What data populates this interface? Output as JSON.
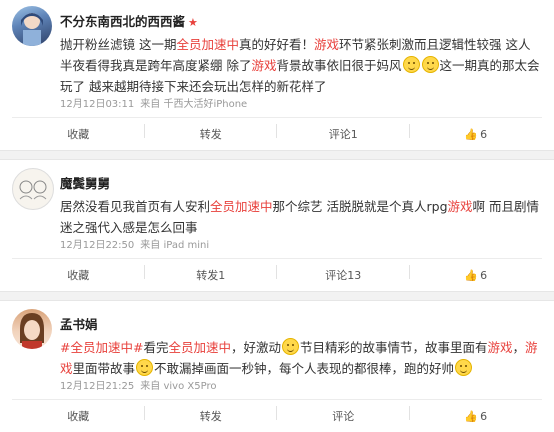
{
  "posts": [
    {
      "username": "不分东南西北的西西酱",
      "segments": [
        {
          "t": "抛开粉丝滤镜 这一期",
          "c": ""
        },
        {
          "t": "全员加速中",
          "c": "red"
        },
        {
          "t": "真的好好看！",
          "c": ""
        },
        {
          "t": "游戏",
          "c": "pink"
        },
        {
          "t": "环节紧张刺激而且逻辑性较强 这人半夜看得我真是跨年高度紧绷 除了",
          "c": ""
        },
        {
          "t": "游戏",
          "c": "pink"
        },
        {
          "t": "背景故事依旧很于妈风",
          "c": ""
        },
        {
          "t": "EMOJI",
          "c": "emoji"
        },
        {
          "t": "EMOJI",
          "c": "emoji"
        },
        {
          "t": "这一期真的那太会玩了 越来越期待接下来还会玩出怎样的新花样了",
          "c": ""
        }
      ],
      "meta": [
        "12月12日03:11",
        "来自 千西大活好iPhone"
      ],
      "actions": {
        "collect": "收藏",
        "repost": "转发",
        "comment": "评论1",
        "like": "6"
      }
    },
    {
      "username": "魔鬓舅舅",
      "segments": [
        {
          "t": "居然没看见我首页有人安利",
          "c": ""
        },
        {
          "t": "全员加速中",
          "c": "red"
        },
        {
          "t": "那个综艺 活脱脱就是个真人rpg",
          "c": ""
        },
        {
          "t": "游戏",
          "c": "pink"
        },
        {
          "t": "啊 而且剧情迷之强代入感是怎么回事",
          "c": ""
        }
      ],
      "meta": [
        "12月12日22:50",
        "来自 iPad mini"
      ],
      "actions": {
        "collect": "收藏",
        "repost": "转发1",
        "comment": "评论13",
        "like": "6"
      }
    },
    {
      "username": "孟书娟",
      "segments": [
        {
          "t": "#全员加速中#",
          "c": "red"
        },
        {
          "t": "看完",
          "c": ""
        },
        {
          "t": "全员加速中",
          "c": "red"
        },
        {
          "t": "，好激动",
          "c": ""
        },
        {
          "t": "EMOJI",
          "c": "emoji"
        },
        {
          "t": "节目精彩的故事情节，故事里面有",
          "c": ""
        },
        {
          "t": "游戏",
          "c": "pink"
        },
        {
          "t": "，",
          "c": ""
        },
        {
          "t": "游戏",
          "c": "pink"
        },
        {
          "t": "里面带故事",
          "c": ""
        },
        {
          "t": "EMOJI",
          "c": "emoji"
        },
        {
          "t": "不敢漏掉画面一秒钟，每个人表现的都很棒，跑的好帅",
          "c": ""
        },
        {
          "t": "EMOJI",
          "c": "emoji"
        }
      ],
      "meta": [
        "12月12日21:25",
        "来自 vivo X5Pro"
      ],
      "actions": {
        "collect": "收藏",
        "repost": "转发",
        "comment": "评论",
        "like": "6"
      }
    }
  ]
}
